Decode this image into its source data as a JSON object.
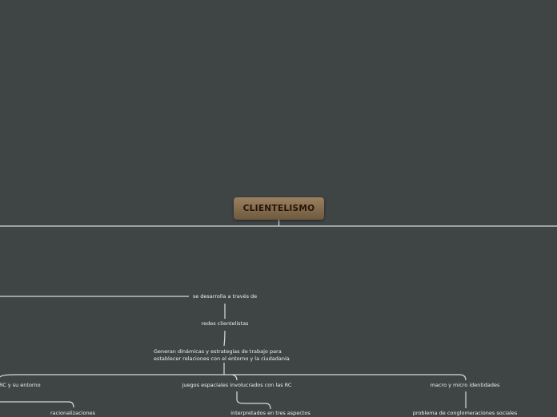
{
  "map": {
    "root": "CLIENTELISMO",
    "nodes": {
      "desarrolla": "se desarrolla a través de",
      "redes": "redes clientelistas",
      "generan_1": "Generan dinámicas y estrategias de trabajo para",
      "generan_2": "establecer relaciones con el entorno y la ciudadanía",
      "rc_entorno": "RC y su entorno",
      "juegos": "juegos espaciales involucrados con las RC",
      "macro": "macro y micro identidades",
      "racionalizaciones": "racionalizaciones",
      "interpretados": "interpretados en tres aspectos",
      "problema": "problema de conglomeraciones sociales"
    }
  },
  "colors": {
    "background": "#3f4545",
    "root_fill": "#8a7050",
    "root_text": "#241608",
    "connector": "#d8dcd8",
    "node_text": "#eef0ee"
  }
}
